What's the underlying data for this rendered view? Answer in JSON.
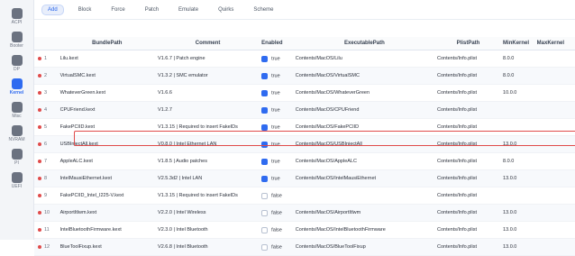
{
  "sidebar": {
    "items": [
      {
        "label": "ACPI",
        "icon": "acpi-icon",
        "active": false
      },
      {
        "label": "Booter",
        "icon": "booter-icon",
        "active": false
      },
      {
        "label": "DP",
        "icon": "device-properties-icon",
        "active": false
      },
      {
        "label": "Kernel",
        "icon": "kernel-icon",
        "active": true
      },
      {
        "label": "Misc",
        "icon": "misc-icon",
        "active": false
      },
      {
        "label": "NVRAM",
        "icon": "nvram-icon",
        "active": false
      },
      {
        "label": "PI",
        "icon": "platform-info-icon",
        "active": false
      },
      {
        "label": "UEFI",
        "icon": "uefi-icon",
        "active": false
      }
    ]
  },
  "tabs": [
    "Add",
    "Block",
    "Force",
    "Patch",
    "Emulate",
    "Quirks",
    "Scheme"
  ],
  "active_tab": "Add",
  "columns": [
    "",
    "BundlePath",
    "Comment",
    "Enabled",
    "ExecutablePath",
    "PlistPath",
    "MinKernel",
    "MaxKernel"
  ],
  "rows": [
    {
      "idx": "1",
      "bundle": "Lilu.kext",
      "comment": "V1.6.7 | Patch engine",
      "enabled": true,
      "enabled_text": "true",
      "exec": "Contents/MacOS/Lilu",
      "plist": "Contents/Info.plist",
      "min": "8.0.0",
      "max": ""
    },
    {
      "idx": "2",
      "bundle": "VirtualSMC.kext",
      "comment": "V1.3.2 | SMC emulator",
      "enabled": true,
      "enabled_text": "true",
      "exec": "Contents/MacOS/VirtualSMC",
      "plist": "Contents/Info.plist",
      "min": "8.0.0",
      "max": ""
    },
    {
      "idx": "3",
      "bundle": "WhateverGreen.kext",
      "comment": "V1.6.6",
      "enabled": true,
      "enabled_text": "true",
      "exec": "Contents/MacOS/WhateverGreen",
      "plist": "Contents/Info.plist",
      "min": "10.0.0",
      "max": ""
    },
    {
      "idx": "4",
      "bundle": "CPUFriend.kext",
      "comment": "V1.2.7",
      "enabled": true,
      "enabled_text": "true",
      "exec": "Contents/MacOS/CPUFriend",
      "plist": "Contents/Info.plist",
      "min": "",
      "max": ""
    },
    {
      "idx": "5",
      "bundle": "FakePCIID.kext",
      "comment": "V1.3.15 | Required to insert FakeIDs",
      "enabled": true,
      "enabled_text": "true",
      "exec": "Contents/MacOS/FakePCIID",
      "plist": "Contents/Info.plist",
      "min": "",
      "max": ""
    },
    {
      "idx": "6",
      "bundle": "USBInjectAll.kext",
      "comment": "V0.8.0 | Intel Ethernet LAN",
      "enabled": true,
      "enabled_text": "true",
      "exec": "Contents/MacOS/USBInjectAll",
      "plist": "Contents/Info.plist",
      "min": "13.0.0",
      "max": ""
    },
    {
      "idx": "7",
      "bundle": "AppleALC.kext",
      "comment": "V1.8.5 | Audio patches",
      "enabled": true,
      "enabled_text": "true",
      "exec": "Contents/MacOS/AppleALC",
      "plist": "Contents/Info.plist",
      "min": "8.0.0",
      "max": ""
    },
    {
      "idx": "8",
      "bundle": "IntelMausiEthernet.kext",
      "comment": "V2.5.3d2 | Intel LAN",
      "enabled": true,
      "enabled_text": "true",
      "exec": "Contents/MacOS/IntelMausiEthernet",
      "plist": "Contents/Info.plist",
      "min": "13.0.0",
      "max": ""
    },
    {
      "idx": "9",
      "bundle": "FakePCIID_Intel_I225-V.kext",
      "comment": "V1.3.15 | Required to insert FakeIDs",
      "enabled": false,
      "enabled_text": "false",
      "exec": "",
      "plist": "Contents/Info.plist",
      "min": "",
      "max": ""
    },
    {
      "idx": "10",
      "bundle": "AirportItlwm.kext",
      "comment": "V2.2.0 | Intel Wireless",
      "enabled": false,
      "enabled_text": "false",
      "exec": "Contents/MacOS/AirportItlwm",
      "plist": "Contents/Info.plist",
      "min": "13.0.0",
      "max": ""
    },
    {
      "idx": "11",
      "bundle": "IntelBluetoothFirmware.kext",
      "comment": "V2.3.0 | Intel Bluetooth",
      "enabled": false,
      "enabled_text": "false",
      "exec": "Contents/MacOS/IntelBluetoothFirmware",
      "plist": "Contents/Info.plist",
      "min": "13.0.0",
      "max": ""
    },
    {
      "idx": "12",
      "bundle": "BlueToolFixup.kext",
      "comment": "V2.6.8 | Intel Bluetooth",
      "enabled": false,
      "enabled_text": "false",
      "exec": "Contents/MacOS/BlueToolFixup",
      "plist": "Contents/Info.plist",
      "min": "13.0.0",
      "max": ""
    }
  ],
  "selected_row": "6",
  "colors": {
    "accent": "#2f6bf0",
    "highlight": "#e04b4b",
    "dot": "#e04b4b"
  }
}
